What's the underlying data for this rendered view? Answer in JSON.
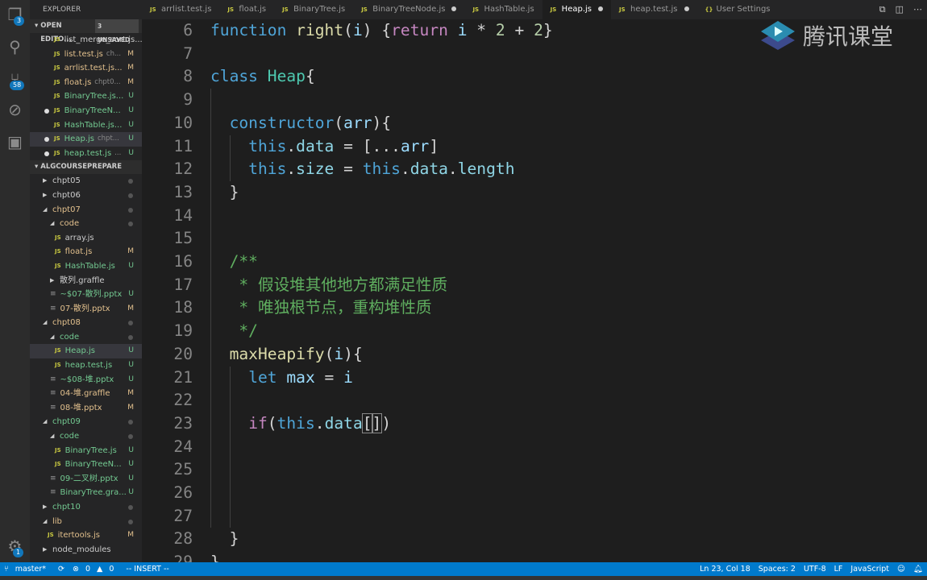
{
  "activity_bar": {
    "explorer_badge": "3",
    "scm_badge": "58",
    "settings_badge": "1"
  },
  "sidebar": {
    "title": "EXPLORER",
    "open_editors": {
      "label": "OPEN EDITO...",
      "unsaved": "3 UNSAVED",
      "items": [
        {
          "name": "list_merge_sort.js...",
          "desc": "",
          "status": "",
          "color": "n",
          "dirty": false
        },
        {
          "name": "list.test.js",
          "desc": "ch...",
          "status": "M",
          "color": "m",
          "dirty": false
        },
        {
          "name": "arrlist.test.js...",
          "desc": "",
          "status": "M",
          "color": "m",
          "dirty": false
        },
        {
          "name": "float.js",
          "desc": "chpt0...",
          "status": "M",
          "color": "m",
          "dirty": false
        },
        {
          "name": "BinaryTree.js...",
          "desc": "",
          "status": "U",
          "color": "u",
          "dirty": false
        },
        {
          "name": "BinaryTreeN...",
          "desc": "",
          "status": "U",
          "color": "u",
          "dirty": true
        },
        {
          "name": "HashTable.js...",
          "desc": "",
          "status": "U",
          "color": "u",
          "dirty": false
        },
        {
          "name": "Heap.js",
          "desc": "chpt...",
          "status": "U",
          "color": "u",
          "dirty": true,
          "selected": true
        },
        {
          "name": "heap.test.js",
          "desc": "...",
          "status": "U",
          "color": "u",
          "dirty": true
        }
      ]
    },
    "project": {
      "label": "ALGCOURSEPREPARE",
      "items": [
        {
          "name": "chpt05",
          "kind": "folder",
          "open": false,
          "depth": 0,
          "status": "dot",
          "color": "n"
        },
        {
          "name": "chpt06",
          "kind": "folder",
          "open": false,
          "depth": 0,
          "status": "dot",
          "color": "n"
        },
        {
          "name": "chpt07",
          "kind": "folder",
          "open": true,
          "depth": 0,
          "status": "dot",
          "color": "m"
        },
        {
          "name": "code",
          "kind": "folder",
          "open": true,
          "depth": 1,
          "status": "dot",
          "color": "m"
        },
        {
          "name": "array.js",
          "kind": "js",
          "depth": 2,
          "status": "",
          "color": "n"
        },
        {
          "name": "float.js",
          "kind": "js",
          "depth": 2,
          "status": "M",
          "color": "m"
        },
        {
          "name": "HashTable.js",
          "kind": "js",
          "depth": 2,
          "status": "U",
          "color": "u"
        },
        {
          "name": "散列.graffle",
          "kind": "folder",
          "open": false,
          "depth": 1,
          "status": "",
          "color": "n"
        },
        {
          "name": "~$07-散列.pptx",
          "kind": "file",
          "depth": 1,
          "status": "U",
          "color": "u"
        },
        {
          "name": "07-散列.pptx",
          "kind": "file",
          "depth": 1,
          "status": "M",
          "color": "m"
        },
        {
          "name": "chpt08",
          "kind": "folder",
          "open": true,
          "depth": 0,
          "status": "dot",
          "color": "m"
        },
        {
          "name": "code",
          "kind": "folder",
          "open": true,
          "depth": 1,
          "status": "dot",
          "color": "u"
        },
        {
          "name": "Heap.js",
          "kind": "js",
          "depth": 2,
          "status": "U",
          "color": "u",
          "selected": true
        },
        {
          "name": "heap.test.js",
          "kind": "js",
          "depth": 2,
          "status": "U",
          "color": "u"
        },
        {
          "name": "~$08-堆.pptx",
          "kind": "file",
          "depth": 1,
          "status": "U",
          "color": "u"
        },
        {
          "name": "04-堆.graffle",
          "kind": "file",
          "depth": 1,
          "status": "M",
          "color": "m"
        },
        {
          "name": "08-堆.pptx",
          "kind": "file",
          "depth": 1,
          "status": "M",
          "color": "m"
        },
        {
          "name": "chpt09",
          "kind": "folder",
          "open": true,
          "depth": 0,
          "status": "dot",
          "color": "u"
        },
        {
          "name": "code",
          "kind": "folder",
          "open": true,
          "depth": 1,
          "status": "dot",
          "color": "u"
        },
        {
          "name": "BinaryTree.js",
          "kind": "js",
          "depth": 2,
          "status": "U",
          "color": "u"
        },
        {
          "name": "BinaryTreeN...",
          "kind": "js",
          "depth": 2,
          "status": "U",
          "color": "u"
        },
        {
          "name": "09-二叉树.pptx",
          "kind": "file",
          "depth": 1,
          "status": "U",
          "color": "u"
        },
        {
          "name": "BinaryTree.gra...",
          "kind": "file",
          "depth": 1,
          "status": "U",
          "color": "u"
        },
        {
          "name": "chpt10",
          "kind": "folder",
          "open": false,
          "depth": 0,
          "status": "dot",
          "color": "u"
        },
        {
          "name": "lib",
          "kind": "folder",
          "open": true,
          "depth": 0,
          "status": "dot",
          "color": "m"
        },
        {
          "name": "itertools.js",
          "kind": "js",
          "depth": 1,
          "status": "M",
          "color": "m"
        },
        {
          "name": "node_modules",
          "kind": "folder",
          "open": false,
          "depth": 0,
          "status": "",
          "color": "n"
        }
      ]
    }
  },
  "tabs": [
    {
      "label": "arrlist.test.js",
      "icon": "JS",
      "dirty": false
    },
    {
      "label": "float.js",
      "icon": "JS",
      "dirty": false
    },
    {
      "label": "BinaryTree.js",
      "icon": "JS",
      "dirty": false
    },
    {
      "label": "BinaryTreeNode.js",
      "icon": "JS",
      "dirty": true
    },
    {
      "label": "HashTable.js",
      "icon": "JS",
      "dirty": false
    },
    {
      "label": "Heap.js",
      "icon": "JS",
      "dirty": true,
      "active": true
    },
    {
      "label": "heap.test.js",
      "icon": "JS",
      "dirty": true
    },
    {
      "label": "User Settings",
      "icon": "{}",
      "dirty": false
    }
  ],
  "watermark": "腾讯课堂",
  "editor": {
    "lines": [
      {
        "n": "6",
        "indent": 0,
        "t": [
          [
            "function",
            "kw"
          ],
          [
            " ",
            "p"
          ],
          [
            "right",
            "fn"
          ],
          [
            "(",
            "p"
          ],
          [
            "i",
            "var"
          ],
          [
            ") {",
            "p"
          ],
          [
            "return",
            "ctl"
          ],
          [
            " ",
            "p"
          ],
          [
            "i",
            "var"
          ],
          [
            " * ",
            "p"
          ],
          [
            "2",
            "num"
          ],
          [
            " + ",
            "p"
          ],
          [
            "2",
            "num"
          ],
          [
            "}",
            "p"
          ]
        ]
      },
      {
        "n": "7",
        "indent": 0,
        "t": []
      },
      {
        "n": "8",
        "indent": 0,
        "t": [
          [
            "class",
            "kw"
          ],
          [
            " ",
            "p"
          ],
          [
            "Heap",
            "cls"
          ],
          [
            "{",
            "p"
          ]
        ]
      },
      {
        "n": "9",
        "indent": 0,
        "t": []
      },
      {
        "n": "10",
        "indent": 2,
        "t": [
          [
            "constructor",
            "kw"
          ],
          [
            "(",
            "p"
          ],
          [
            "arr",
            "var"
          ],
          [
            "){",
            "p"
          ]
        ]
      },
      {
        "n": "11",
        "indent": 4,
        "t": [
          [
            "this",
            "kw"
          ],
          [
            ".",
            "p"
          ],
          [
            "data",
            "prop"
          ],
          [
            " = [...",
            "p"
          ],
          [
            "arr",
            "var"
          ],
          [
            "]",
            "p"
          ]
        ]
      },
      {
        "n": "12",
        "indent": 4,
        "t": [
          [
            "this",
            "kw"
          ],
          [
            ".",
            "p"
          ],
          [
            "size",
            "prop"
          ],
          [
            " = ",
            "p"
          ],
          [
            "this",
            "kw"
          ],
          [
            ".",
            "p"
          ],
          [
            "data",
            "prop"
          ],
          [
            ".",
            "p"
          ],
          [
            "length",
            "prop"
          ]
        ]
      },
      {
        "n": "13",
        "indent": 2,
        "t": [
          [
            "}",
            "p"
          ]
        ]
      },
      {
        "n": "14",
        "indent": 0,
        "t": []
      },
      {
        "n": "15",
        "indent": 0,
        "t": []
      },
      {
        "n": "16",
        "indent": 2,
        "t": [
          [
            "/**",
            "cm"
          ]
        ]
      },
      {
        "n": "17",
        "indent": 2,
        "t": [
          [
            " * 假设堆其他地方都满足性质",
            "cm"
          ]
        ]
      },
      {
        "n": "18",
        "indent": 2,
        "t": [
          [
            " * 唯独根节点，重构堆性质",
            "cm"
          ]
        ]
      },
      {
        "n": "19",
        "indent": 2,
        "t": [
          [
            " */",
            "cm"
          ]
        ]
      },
      {
        "n": "20",
        "indent": 2,
        "t": [
          [
            "maxHeapify",
            "fn"
          ],
          [
            "(",
            "p"
          ],
          [
            "i",
            "var"
          ],
          [
            "){",
            "p"
          ]
        ]
      },
      {
        "n": "21",
        "indent": 4,
        "t": [
          [
            "let",
            "kw"
          ],
          [
            " ",
            "p"
          ],
          [
            "max",
            "var"
          ],
          [
            " = ",
            "p"
          ],
          [
            "i",
            "var"
          ]
        ]
      },
      {
        "n": "22",
        "indent": 0,
        "t": []
      },
      {
        "n": "23",
        "indent": 4,
        "t": [
          [
            "if",
            "ctl"
          ],
          [
            "(",
            "p"
          ],
          [
            "this",
            "kw"
          ],
          [
            ".",
            "p"
          ],
          [
            "data",
            "prop"
          ],
          [
            "[",
            "cur"
          ],
          [
            "]",
            "cur"
          ],
          [
            ")",
            "p"
          ]
        ]
      },
      {
        "n": "24",
        "indent": 0,
        "t": []
      },
      {
        "n": "25",
        "indent": 0,
        "t": []
      },
      {
        "n": "26",
        "indent": 0,
        "t": []
      },
      {
        "n": "27",
        "indent": 0,
        "t": []
      },
      {
        "n": "28",
        "indent": 2,
        "t": [
          [
            "}",
            "p"
          ]
        ]
      },
      {
        "n": "29",
        "indent": 0,
        "t": [
          [
            "}",
            "p"
          ]
        ]
      }
    ]
  },
  "status": {
    "branch": "master*",
    "errors": "0",
    "warnings": "0",
    "mode": "-- INSERT --",
    "position": "Ln 23, Col 18",
    "spaces": "Spaces: 2",
    "encoding": "UTF-8",
    "eol": "LF",
    "language": "JavaScript"
  }
}
